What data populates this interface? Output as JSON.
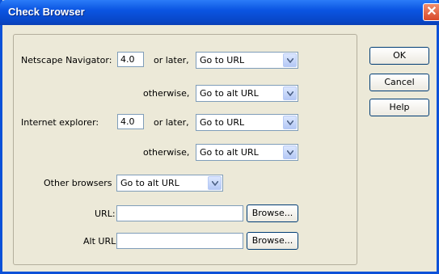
{
  "window": {
    "title": "Check Browser"
  },
  "netscape": {
    "label": "Netscape Navigator:",
    "version": "4.0",
    "or_later_label": "or later,",
    "action": "Go to URL",
    "otherwise_label": "otherwise,",
    "otherwise_action": "Go to alt URL"
  },
  "ie": {
    "label": "Internet explorer:",
    "version": "4.0",
    "or_later_label": "or later,",
    "action": "Go to URL",
    "otherwise_label": "otherwise,",
    "otherwise_action": "Go to alt URL"
  },
  "other": {
    "label": "Other browsers",
    "action": "Go to alt URL"
  },
  "url": {
    "label": "URL:",
    "value": "",
    "browse_label": "Browse..."
  },
  "alt_url": {
    "label": "Alt URL:",
    "value": "",
    "browse_label": "Browse..."
  },
  "buttons": {
    "ok": "OK",
    "cancel": "Cancel",
    "help": "Help"
  }
}
